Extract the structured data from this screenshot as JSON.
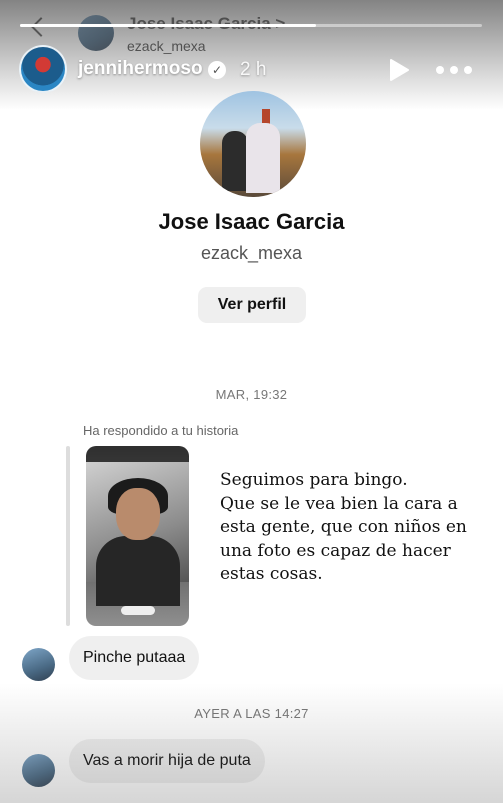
{
  "story": {
    "progress_fraction": 0.64,
    "author": "jennihermoso",
    "verified_icon": "verified-badge-icon",
    "posted": "2 h",
    "play_icon": "play-icon",
    "more_icon": "more-horizontal-icon"
  },
  "dm_header": {
    "name": "Jose Isaac Garcia",
    "chevron": ">",
    "username": "ezack_mexa"
  },
  "profile": {
    "name": "Jose Isaac Garcia",
    "username": "ezack_mexa",
    "view_profile_label": "Ver perfil"
  },
  "thread": {
    "timestamp_1": "MAR, 19:32",
    "reply_label": "Ha respondido a tu historia",
    "story_text_lines": [
      "Seguimos para bingo.",
      "Que se le vea bien la cara a",
      "esta gente, que con niños en",
      "una foto es capaz de hacer",
      "estas cosas."
    ],
    "message_1": "Pinche putaaa",
    "timestamp_2": "AYER A LAS 14:27",
    "message_2": "Vas a morir hija de puta"
  },
  "colors": {
    "bubble_bg": "#efefef",
    "button_bg": "#efefef",
    "timestamp_text": "#777777"
  }
}
